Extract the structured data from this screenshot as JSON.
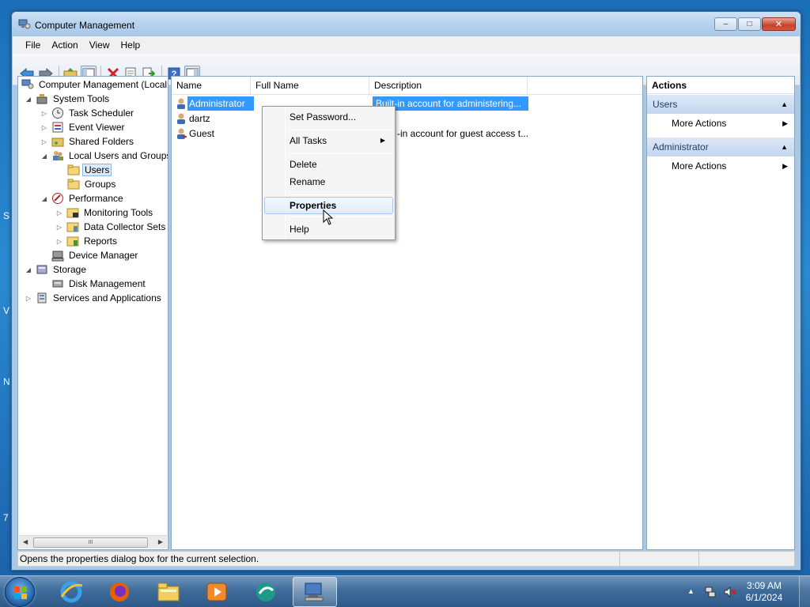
{
  "window": {
    "title": "Computer Management",
    "minimize_glyph": "–",
    "maximize_glyph": "□",
    "close_glyph": "✕"
  },
  "menu": [
    "File",
    "Action",
    "View",
    "Help"
  ],
  "tree": {
    "root": "Computer Management (Local",
    "system_tools": "System Tools",
    "task_scheduler": "Task Scheduler",
    "event_viewer": "Event Viewer",
    "shared_folders": "Shared Folders",
    "local_users_groups": "Local Users and Groups",
    "users": "Users",
    "groups": "Groups",
    "performance": "Performance",
    "monitoring_tools": "Monitoring Tools",
    "data_collector_sets": "Data Collector Sets",
    "reports": "Reports",
    "device_manager": "Device Manager",
    "storage": "Storage",
    "disk_management": "Disk Management",
    "services_apps": "Services and Applications",
    "scroll_grip": "III"
  },
  "list": {
    "columns": [
      "Name",
      "Full Name",
      "Description"
    ],
    "rows": [
      {
        "name": "Administrator",
        "full_name": "",
        "description": "Built-in account for administering..."
      },
      {
        "name": "dartz",
        "full_name": "",
        "description": ""
      },
      {
        "name": "Guest",
        "full_name": "",
        "description": "Built-in account for guest access t..."
      }
    ],
    "guest_desc_visible": "-in account for guest access t..."
  },
  "actions": {
    "header": "Actions",
    "group1": "Users",
    "group1_item": "More Actions",
    "group2": "Administrator",
    "group2_item": "More Actions"
  },
  "context_menu": {
    "set_password": "Set Password...",
    "all_tasks": "All Tasks",
    "delete": "Delete",
    "rename": "Rename",
    "properties": "Properties",
    "help": "Help"
  },
  "status": "Opens the properties dialog box for the current selection.",
  "clock": {
    "time": "3:09 AM",
    "date": "6/1/2024"
  },
  "colors": {
    "selection": "#3399ff",
    "accent": "#1e3f66"
  }
}
